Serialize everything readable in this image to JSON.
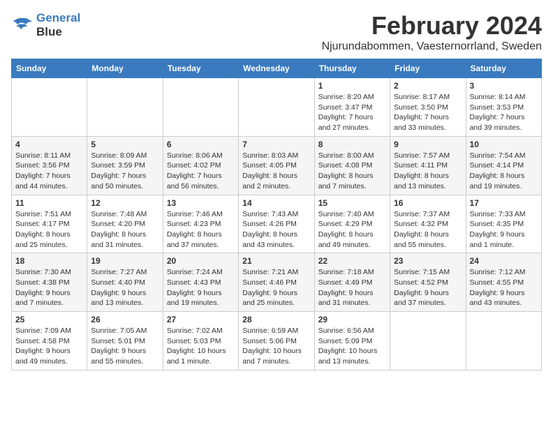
{
  "header": {
    "logo_line1": "General",
    "logo_line2": "Blue",
    "month_year": "February 2024",
    "location": "Njurundabommen, Vaesternorrland, Sweden"
  },
  "weekdays": [
    "Sunday",
    "Monday",
    "Tuesday",
    "Wednesday",
    "Thursday",
    "Friday",
    "Saturday"
  ],
  "weeks": [
    [
      {
        "day": "",
        "info": ""
      },
      {
        "day": "",
        "info": ""
      },
      {
        "day": "",
        "info": ""
      },
      {
        "day": "",
        "info": ""
      },
      {
        "day": "1",
        "info": "Sunrise: 8:20 AM\nSunset: 3:47 PM\nDaylight: 7 hours\nand 27 minutes."
      },
      {
        "day": "2",
        "info": "Sunrise: 8:17 AM\nSunset: 3:50 PM\nDaylight: 7 hours\nand 33 minutes."
      },
      {
        "day": "3",
        "info": "Sunrise: 8:14 AM\nSunset: 3:53 PM\nDaylight: 7 hours\nand 39 minutes."
      }
    ],
    [
      {
        "day": "4",
        "info": "Sunrise: 8:11 AM\nSunset: 3:56 PM\nDaylight: 7 hours\nand 44 minutes."
      },
      {
        "day": "5",
        "info": "Sunrise: 8:09 AM\nSunset: 3:59 PM\nDaylight: 7 hours\nand 50 minutes."
      },
      {
        "day": "6",
        "info": "Sunrise: 8:06 AM\nSunset: 4:02 PM\nDaylight: 7 hours\nand 56 minutes."
      },
      {
        "day": "7",
        "info": "Sunrise: 8:03 AM\nSunset: 4:05 PM\nDaylight: 8 hours\nand 2 minutes."
      },
      {
        "day": "8",
        "info": "Sunrise: 8:00 AM\nSunset: 4:08 PM\nDaylight: 8 hours\nand 7 minutes."
      },
      {
        "day": "9",
        "info": "Sunrise: 7:57 AM\nSunset: 4:11 PM\nDaylight: 8 hours\nand 13 minutes."
      },
      {
        "day": "10",
        "info": "Sunrise: 7:54 AM\nSunset: 4:14 PM\nDaylight: 8 hours\nand 19 minutes."
      }
    ],
    [
      {
        "day": "11",
        "info": "Sunrise: 7:51 AM\nSunset: 4:17 PM\nDaylight: 8 hours\nand 25 minutes."
      },
      {
        "day": "12",
        "info": "Sunrise: 7:48 AM\nSunset: 4:20 PM\nDaylight: 8 hours\nand 31 minutes."
      },
      {
        "day": "13",
        "info": "Sunrise: 7:46 AM\nSunset: 4:23 PM\nDaylight: 8 hours\nand 37 minutes."
      },
      {
        "day": "14",
        "info": "Sunrise: 7:43 AM\nSunset: 4:26 PM\nDaylight: 8 hours\nand 43 minutes."
      },
      {
        "day": "15",
        "info": "Sunrise: 7:40 AM\nSunset: 4:29 PM\nDaylight: 8 hours\nand 49 minutes."
      },
      {
        "day": "16",
        "info": "Sunrise: 7:37 AM\nSunset: 4:32 PM\nDaylight: 8 hours\nand 55 minutes."
      },
      {
        "day": "17",
        "info": "Sunrise: 7:33 AM\nSunset: 4:35 PM\nDaylight: 9 hours\nand 1 minute."
      }
    ],
    [
      {
        "day": "18",
        "info": "Sunrise: 7:30 AM\nSunset: 4:38 PM\nDaylight: 9 hours\nand 7 minutes."
      },
      {
        "day": "19",
        "info": "Sunrise: 7:27 AM\nSunset: 4:40 PM\nDaylight: 9 hours\nand 13 minutes."
      },
      {
        "day": "20",
        "info": "Sunrise: 7:24 AM\nSunset: 4:43 PM\nDaylight: 9 hours\nand 19 minutes."
      },
      {
        "day": "21",
        "info": "Sunrise: 7:21 AM\nSunset: 4:46 PM\nDaylight: 9 hours\nand 25 minutes."
      },
      {
        "day": "22",
        "info": "Sunrise: 7:18 AM\nSunset: 4:49 PM\nDaylight: 9 hours\nand 31 minutes."
      },
      {
        "day": "23",
        "info": "Sunrise: 7:15 AM\nSunset: 4:52 PM\nDaylight: 9 hours\nand 37 minutes."
      },
      {
        "day": "24",
        "info": "Sunrise: 7:12 AM\nSunset: 4:55 PM\nDaylight: 9 hours\nand 43 minutes."
      }
    ],
    [
      {
        "day": "25",
        "info": "Sunrise: 7:09 AM\nSunset: 4:58 PM\nDaylight: 9 hours\nand 49 minutes."
      },
      {
        "day": "26",
        "info": "Sunrise: 7:05 AM\nSunset: 5:01 PM\nDaylight: 9 hours\nand 55 minutes."
      },
      {
        "day": "27",
        "info": "Sunrise: 7:02 AM\nSunset: 5:03 PM\nDaylight: 10 hours\nand 1 minute."
      },
      {
        "day": "28",
        "info": "Sunrise: 6:59 AM\nSunset: 5:06 PM\nDaylight: 10 hours\nand 7 minutes."
      },
      {
        "day": "29",
        "info": "Sunrise: 6:56 AM\nSunset: 5:09 PM\nDaylight: 10 hours\nand 13 minutes."
      },
      {
        "day": "",
        "info": ""
      },
      {
        "day": "",
        "info": ""
      }
    ]
  ]
}
